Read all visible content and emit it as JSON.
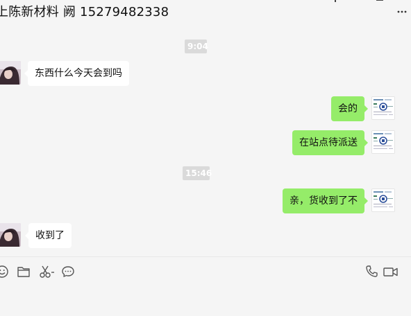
{
  "header": {
    "title": "上陈新材料 阙 15279482338"
  },
  "icons": {
    "more": "more-dots-icon",
    "emoji": "emoji-icon",
    "folder": "folder-icon",
    "scissors": "screenshot-scissors-icon",
    "chat": "chat-history-icon",
    "phone": "voice-call-icon",
    "video": "video-call-icon"
  },
  "colors": {
    "outgoing_bubble": "#95ec69",
    "incoming_bubble": "#ffffff",
    "background": "#f5f5f5",
    "time_chip": "#dadada"
  },
  "messages": [
    {
      "type": "time",
      "text": "9:04"
    },
    {
      "type": "incoming",
      "text": "东西什么今天会到吗"
    },
    {
      "type": "outgoing",
      "text": "会的"
    },
    {
      "type": "outgoing",
      "text": "在站点待派送"
    },
    {
      "type": "time",
      "text": "15:46"
    },
    {
      "type": "outgoing",
      "text": "亲，货收到了不"
    },
    {
      "type": "incoming",
      "text": "收到了"
    }
  ]
}
